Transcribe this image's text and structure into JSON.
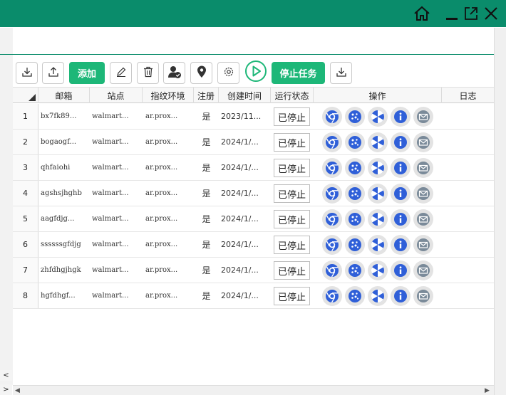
{
  "colors": {
    "titlebar": "#0a8c6b",
    "accent_green": "#1db778",
    "icon_blue": "#2f5fd8"
  },
  "window": {
    "icons": [
      "home-icon",
      "minimize-icon",
      "popout-icon",
      "close-icon"
    ]
  },
  "toolbar": {
    "add_label": "添加",
    "stop_task_label": "停止任务"
  },
  "table": {
    "columns": [
      "邮箱",
      "站点",
      "指纹环境",
      "注册",
      "创建时间",
      "运行状态",
      "操作",
      "日志"
    ],
    "rows": [
      {
        "index": "1",
        "email": "bx7fk89...",
        "site": "walmart...",
        "env": "ar.prox...",
        "registered": "是",
        "created": "2023/11...",
        "status": "已停止"
      },
      {
        "index": "2",
        "email": "bogaogf...",
        "site": "walmart...",
        "env": "ar.prox...",
        "registered": "是",
        "created": "2024/1/...",
        "status": "已停止"
      },
      {
        "index": "3",
        "email": "qhfaiohi",
        "site": "walmart...",
        "env": "ar.prox...",
        "registered": "是",
        "created": "2024/1/...",
        "status": "已停止"
      },
      {
        "index": "4",
        "email": "agshsjhghb",
        "site": "walmart...",
        "env": "ar.prox...",
        "registered": "是",
        "created": "2024/1/...",
        "status": "已停止"
      },
      {
        "index": "5",
        "email": "aagfdjg...",
        "site": "walmart...",
        "env": "ar.prox...",
        "registered": "是",
        "created": "2024/1/...",
        "status": "已停止"
      },
      {
        "index": "6",
        "email": "ssssssgfdjg",
        "site": "walmart...",
        "env": "ar.prox...",
        "registered": "是",
        "created": "2024/1/...",
        "status": "已停止"
      },
      {
        "index": "7",
        "email": "zhfdhgjhgk",
        "site": "walmart...",
        "env": "ar.prox...",
        "registered": "是",
        "created": "2024/1/...",
        "status": "已停止"
      },
      {
        "index": "8",
        "email": "hgfdhgf...",
        "site": "walmart...",
        "env": "ar.prox...",
        "registered": "是",
        "created": "2024/1/...",
        "status": "已停止"
      }
    ],
    "operation_icons": [
      "chrome-icon",
      "cookie-icon",
      "aperture-icon",
      "info-icon",
      "mail-icon"
    ]
  },
  "scroll": {
    "left_arrow": "<",
    "right_arrow": ">"
  }
}
